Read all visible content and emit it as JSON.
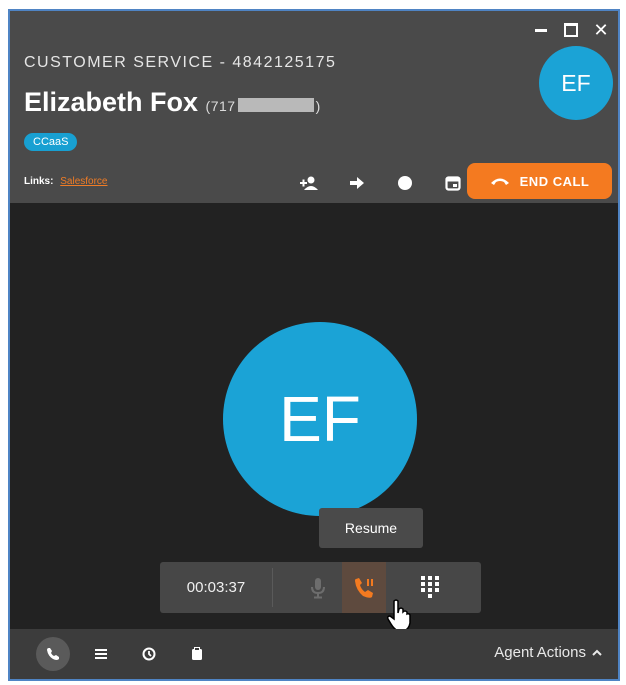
{
  "header": {
    "queue_title": "CUSTOMER SERVICE - 4842125175",
    "caller_name": "Elizabeth Fox",
    "caller_phone_prefix": "(717",
    "caller_phone_suffix": ")",
    "avatar_initials": "EF",
    "tag": "CCaaS",
    "links_label": "Links:",
    "links": [
      "Salesforce"
    ],
    "end_call_label": "END CALL"
  },
  "window_controls": [
    "minimize-icon",
    "maximize-icon",
    "close-icon"
  ],
  "action_icons": [
    "add-user-icon",
    "transfer-arrow-icon",
    "circle-icon",
    "calendar-icon"
  ],
  "call": {
    "avatar_initials": "EF",
    "tooltip": "Resume",
    "timer": "00:03:37",
    "controls": [
      "microphone-icon",
      "hold-resume-icon",
      "dialpad-icon"
    ]
  },
  "footer": {
    "icons": [
      "phone-icon",
      "list-icon",
      "history-icon",
      "clipboard-icon"
    ],
    "agent_actions_label": "Agent Actions"
  },
  "colors": {
    "accent_blue": "#1ba3d6",
    "end_call_orange": "#f47a20",
    "link_orange": "#f07c25",
    "header_bg": "#4a4a4a",
    "body_bg": "#222222",
    "frame_border": "#4f84c4"
  }
}
